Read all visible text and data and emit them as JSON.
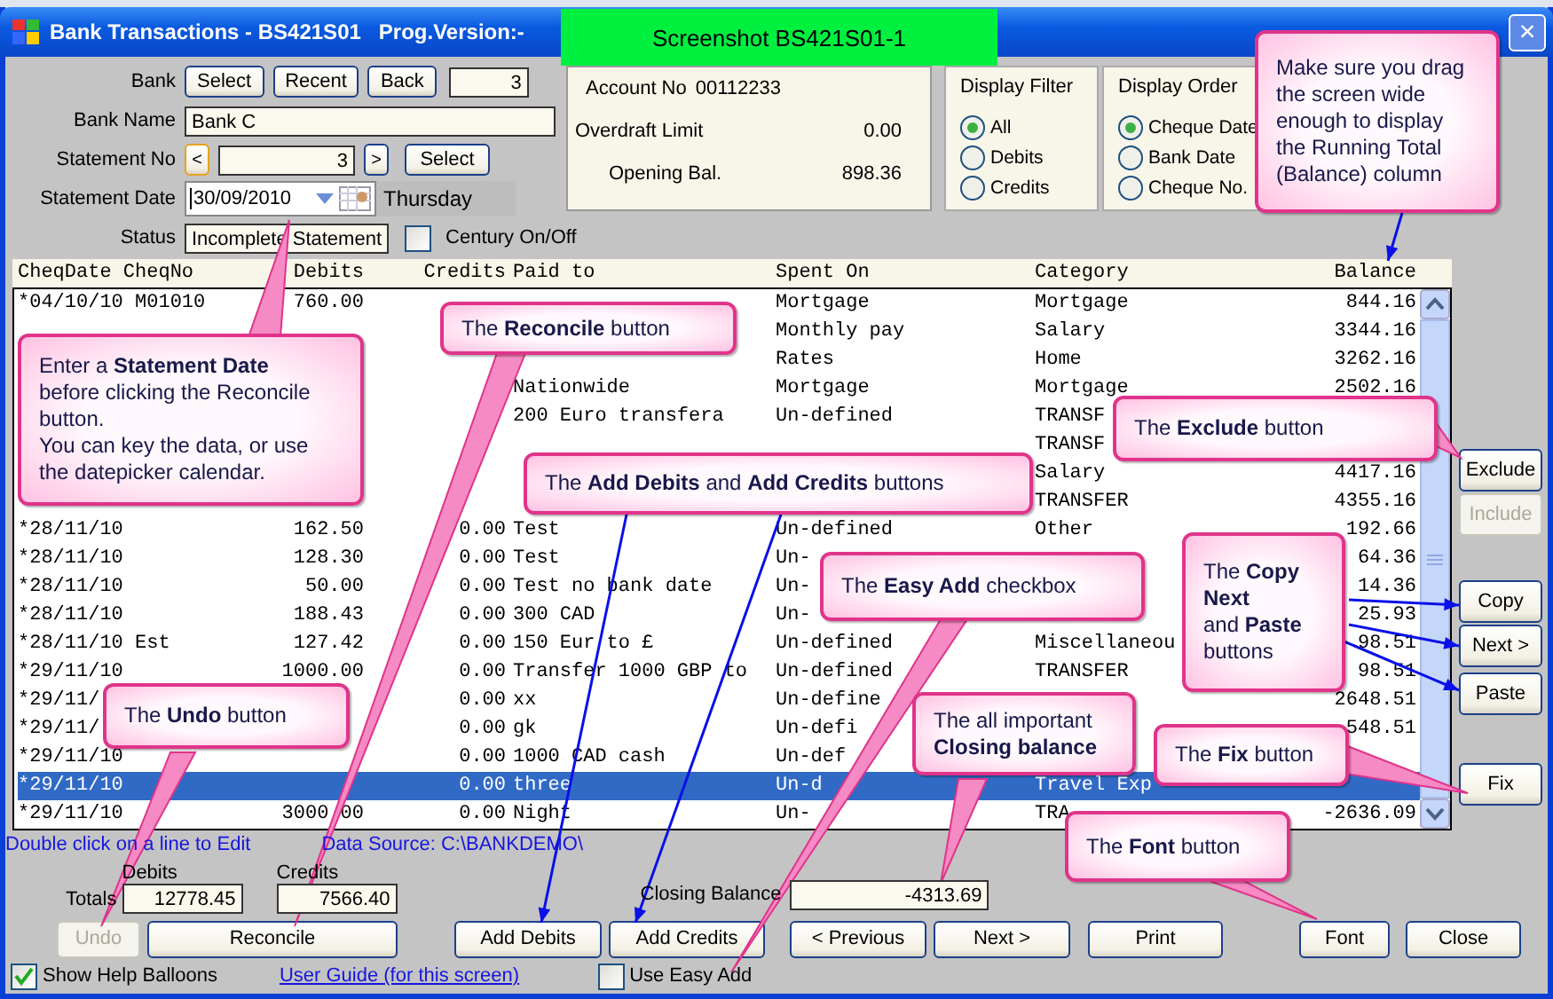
{
  "window": {
    "title": "Bank Transactions - BS421S01   Prog.Version:-",
    "close": "×"
  },
  "screenshot_label": "Screenshot BS421S01-1",
  "bank": {
    "label": "Bank",
    "buttons": [
      "Select",
      "Recent",
      "Back"
    ],
    "number": "3"
  },
  "bank_name": {
    "label": "Bank Name",
    "value": "Bank C"
  },
  "statement_no": {
    "label": "Statement No",
    "prev": "<",
    "value": "3",
    "next": ">",
    "button": "Select"
  },
  "statement_date": {
    "label": "Statement Date",
    "value": "30/09/2010",
    "day": "Thursday"
  },
  "status": {
    "label": "Status",
    "value": "Incomplete Statement"
  },
  "century": {
    "label": "Century On/Off",
    "checked": false
  },
  "account": {
    "account_no_label": "Account No",
    "account_no": "00112233",
    "overdraft_label": "Overdraft Limit",
    "overdraft": "0.00",
    "opening_label": "Opening Bal.",
    "opening": "898.36"
  },
  "display_filter": {
    "title": "Display Filter",
    "options": [
      {
        "label": "All",
        "selected": true
      },
      {
        "label": "Debits",
        "selected": false
      },
      {
        "label": "Credits",
        "selected": false
      }
    ]
  },
  "display_order": {
    "title": "Display Order",
    "options": [
      {
        "label": "Cheque Date",
        "selected": true
      },
      {
        "label": "Bank Date",
        "selected": false
      },
      {
        "label": "Cheque No.",
        "selected": false
      }
    ]
  },
  "table": {
    "columns": [
      "CheqDate CheqNo",
      "Debits",
      "Credits",
      "Paid to",
      "Spent On",
      "Category",
      "Balance"
    ],
    "rows": [
      {
        "selected": false,
        "cells": [
          "*04/10/10 M01010",
          "760.00",
          null,
          null,
          "Mortgage",
          "Mortgage",
          "844.16"
        ]
      },
      {
        "selected": false,
        "cells": [
          null,
          null,
          null,
          null,
          "Monthly pay",
          "Salary",
          "3344.16"
        ]
      },
      {
        "selected": false,
        "cells": [
          null,
          null,
          null,
          null,
          "Rates",
          "Home",
          "3262.16"
        ]
      },
      {
        "selected": false,
        "cells": [
          null,
          null,
          null,
          "Nationwide",
          "Mortgage",
          "Mortgage",
          "2502.16"
        ]
      },
      {
        "selected": false,
        "cells": [
          null,
          null,
          null,
          "200 Euro transfera",
          "Un-defined",
          "TRANSF",
          null
        ]
      },
      {
        "selected": false,
        "cells": [
          null,
          null,
          null,
          null,
          null,
          "TRANSF",
          null
        ]
      },
      {
        "selected": false,
        "cells": [
          null,
          null,
          null,
          null,
          null,
          "Salary",
          "4417.16"
        ]
      },
      {
        "selected": false,
        "cells": [
          null,
          null,
          null,
          null,
          null,
          "TRANSFER",
          "4355.16"
        ]
      },
      {
        "selected": false,
        "cells": [
          "*28/11/10",
          "162.50",
          "0.00",
          "Test",
          "Un-defined",
          "Other",
          "192.66"
        ]
      },
      {
        "selected": false,
        "cells": [
          "*28/11/10",
          "128.30",
          "0.00",
          "Test",
          "Un-",
          null,
          "64.36"
        ]
      },
      {
        "selected": false,
        "cells": [
          "*28/11/10",
          "50.00",
          "0.00",
          "Test no bank date",
          "Un-",
          null,
          "14.36"
        ]
      },
      {
        "selected": false,
        "cells": [
          "*28/11/10",
          "188.43",
          "0.00",
          "300 CAD",
          "Un-",
          null,
          "25.93"
        ]
      },
      {
        "selected": false,
        "cells": [
          "*28/11/10 Est",
          "127.42",
          "0.00",
          "150 Eur to £",
          "Un-defined",
          "Miscellaneou",
          "98.51"
        ]
      },
      {
        "selected": false,
        "cells": [
          "*29/11/10",
          "1000.00",
          "0.00",
          "Transfer 1000 GBP to",
          "Un-defined",
          "TRANSFER",
          "98.51"
        ]
      },
      {
        "selected": false,
        "cells": [
          "*29/11/",
          null,
          "0.00",
          "xx",
          "Un-define",
          null,
          "2648.51"
        ]
      },
      {
        "selected": false,
        "cells": [
          "*29/11/",
          null,
          "0.00",
          "gk",
          "Un-defi",
          null,
          "548.51"
        ]
      },
      {
        "selected": false,
        "cells": [
          "*29/11/10",
          null,
          "0.00",
          "1000 CAD cash",
          "Un-def",
          null,
          null
        ]
      },
      {
        "selected": true,
        "cells": [
          "*29/11/10",
          null,
          "0.00",
          "three",
          "Un-d",
          "Travel Exp",
          null
        ]
      },
      {
        "selected": false,
        "cells": [
          "*29/11/10",
          "3000.00",
          "0.00",
          "Night",
          "Un-",
          "TRA",
          "-2636.09"
        ]
      }
    ]
  },
  "side_buttons": [
    {
      "label": "Exclude",
      "disabled": false
    },
    {
      "label": "Include",
      "disabled": true
    },
    {
      "label": "Copy",
      "disabled": false
    },
    {
      "label": "Next >",
      "disabled": false
    },
    {
      "label": "Paste",
      "disabled": false
    },
    {
      "label": "Fix",
      "disabled": false
    }
  ],
  "hint": "Double click on a line to Edit",
  "data_source": "Data Source: C:\\BANKDEMO\\",
  "totals": {
    "label": "Totals",
    "debits_label": "Debits",
    "debits": "12778.45",
    "credits_label": "Credits",
    "credits": "7566.40"
  },
  "closing_balance": {
    "label": "Closing Balance",
    "value": "-4313.69"
  },
  "buttons": [
    {
      "label": "Undo",
      "disabled": true
    },
    {
      "label": "Reconcile",
      "disabled": false
    },
    {
      "label": "Add Debits",
      "disabled": false
    },
    {
      "label": "Add Credits",
      "disabled": false
    },
    {
      "label": "< Previous",
      "disabled": false
    },
    {
      "label": "Next >",
      "disabled": false
    },
    {
      "label": "Print",
      "disabled": false
    },
    {
      "label": "Font",
      "disabled": false
    },
    {
      "label": "Close",
      "disabled": false
    }
  ],
  "show_help": {
    "label": "Show Help Balloons",
    "checked": true
  },
  "user_guide": "User Guide (for this screen)",
  "easy_add": {
    "label": "Use Easy Add",
    "checked": false
  },
  "callouts": [
    {
      "text": "Enter a **Statement Date**\nbefore clicking the Reconcile button.\nYou can key the data, or use the datepicker calendar."
    },
    {
      "text": "The **Reconcile** button"
    },
    {
      "text": "The **Add Debits** and **Add Credits** buttons"
    },
    {
      "text": "The **Easy Add** checkbox"
    },
    {
      "text": "The **Exclude** button"
    },
    {
      "text": "The **Copy**\n**Next**\nand **Paste**\n buttons"
    },
    {
      "text": "The **Undo** button"
    },
    {
      "text": "The all important\n**Closing balance**"
    },
    {
      "text": "The **Fix** button"
    },
    {
      "text": "The **Font** button"
    },
    {
      "text": "Make sure you drag the screen wide enough to display the Running Total (Balance) column"
    }
  ]
}
